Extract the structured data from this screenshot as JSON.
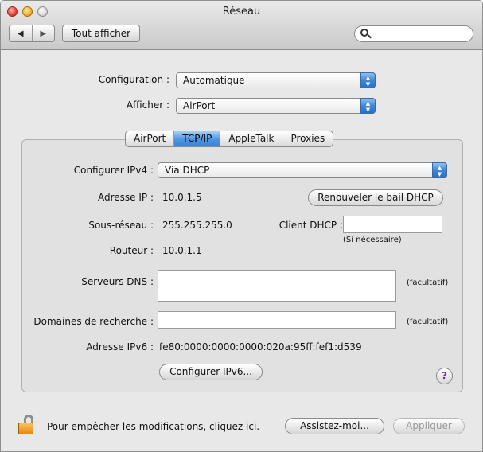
{
  "window": {
    "title": "Réseau"
  },
  "toolbar": {
    "back_label": "◀",
    "forward_label": "▶",
    "show_all_label": "Tout afficher",
    "search_value": ""
  },
  "config": {
    "configuration_label": "Configuration :",
    "configuration_value": "Automatique",
    "afficher_label": "Afficher :",
    "afficher_value": "AirPort"
  },
  "tabs": [
    {
      "label": "AirPort",
      "active": false
    },
    {
      "label": "TCP/IP",
      "active": true
    },
    {
      "label": "AppleTalk",
      "active": false
    },
    {
      "label": "Proxies",
      "active": false
    }
  ],
  "tcpip": {
    "configure_ipv4_label": "Configurer IPv4 :",
    "configure_ipv4_value": "Via DHCP",
    "ip_label": "Adresse IP :",
    "ip_value": "10.0.1.5",
    "renew_button": "Renouveler le bail DHCP",
    "subnet_label": "Sous-réseau :",
    "subnet_value": "255.255.255.0",
    "dhcp_client_label": "Client DHCP :",
    "dhcp_client_value": "",
    "dhcp_client_hint": "(Si nécessaire)",
    "router_label": "Routeur :",
    "router_value": "10.0.1.1",
    "dns_label": "Serveurs DNS :",
    "dns_value": "",
    "dns_hint": "(facultatif)",
    "search_domains_label": "Domaines de recherche :",
    "search_domains_value": "",
    "search_domains_hint": "(facultatif)",
    "ipv6_label": "Adresse IPv6 :",
    "ipv6_value": "fe80:0000:0000:0000:020a:95ff:fef1:d539",
    "configure_ipv6_button": "Configurer IPv6...",
    "help_label": "?"
  },
  "footer": {
    "lock_text": "Pour empêcher les modifications, cliquez ici.",
    "assist_button": "Assistez-moi...",
    "apply_button": "Appliquer"
  }
}
